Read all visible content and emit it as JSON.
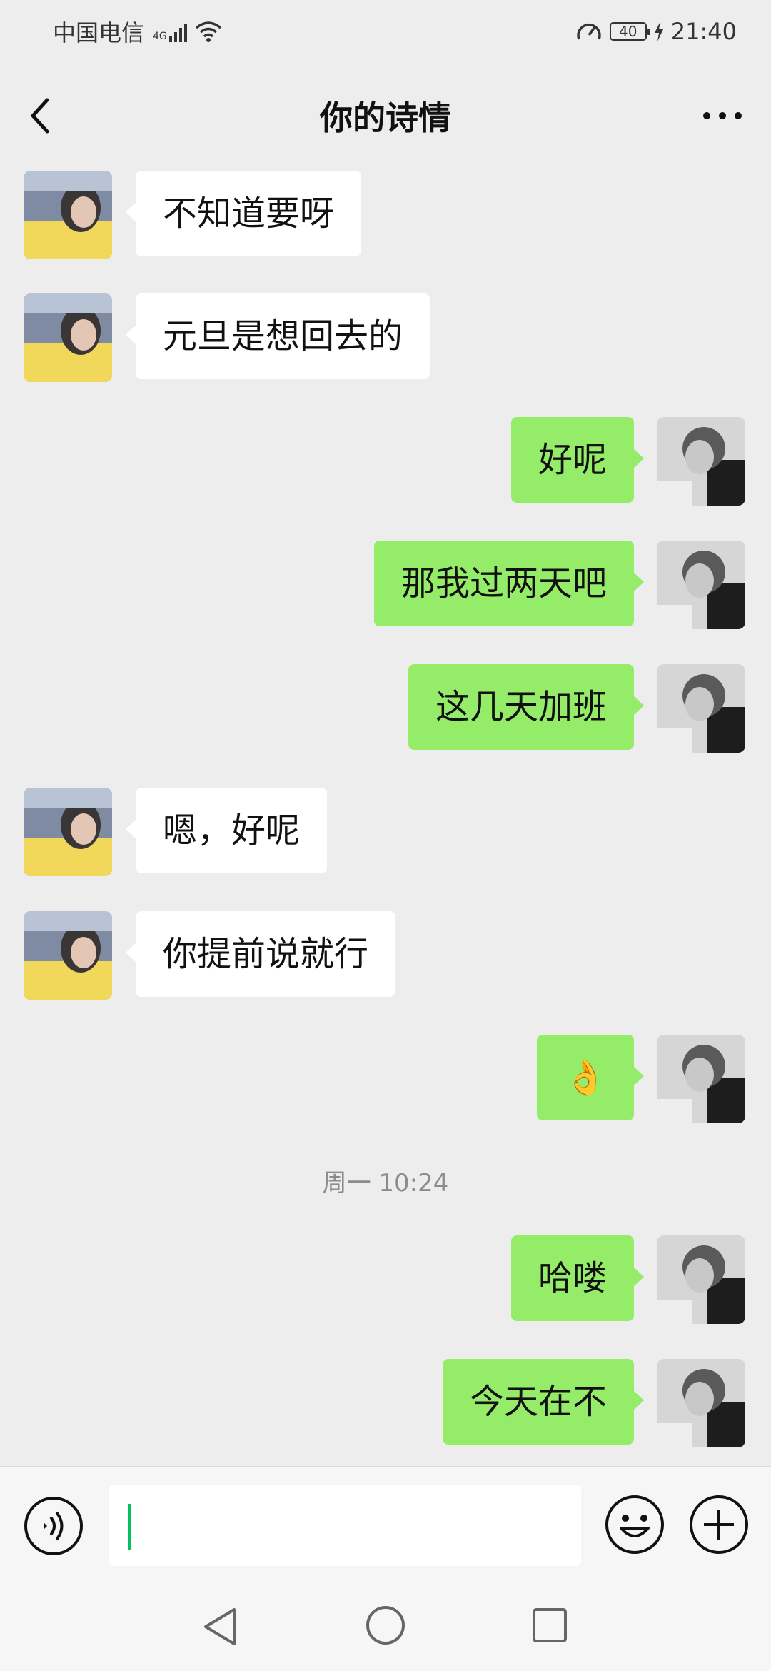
{
  "status_bar": {
    "carrier": "中国电信",
    "network_type": "4G",
    "battery": "40",
    "time": "21:40"
  },
  "header": {
    "title": "你的诗情",
    "back_icon": "chevron-left-icon",
    "more_icon": "more-horizontal-icon"
  },
  "messages": [
    {
      "side": "left",
      "text": "不知道要呀"
    },
    {
      "side": "left",
      "text": "元旦是想回去的"
    },
    {
      "side": "right",
      "text": "好呢"
    },
    {
      "side": "right",
      "text": "那我过两天吧"
    },
    {
      "side": "right",
      "text": "这几天加班"
    },
    {
      "side": "left",
      "text": "嗯，好呢"
    },
    {
      "side": "left",
      "text": "你提前说就行"
    },
    {
      "side": "right",
      "text": "👌"
    },
    {
      "side": "right",
      "text": "哈喽"
    },
    {
      "side": "right",
      "text": "今天在不"
    }
  ],
  "timestamp": "周一 10:24",
  "input_bar": {
    "voice_icon": "voice-icon",
    "emoji_icon": "emoji-icon",
    "plus_icon": "plus-icon",
    "value": ""
  },
  "nav_bar": {
    "back_icon": "triangle-back-icon",
    "home_icon": "circle-home-icon",
    "recent_icon": "square-recent-icon"
  },
  "colors": {
    "background": "#ededed",
    "outgoing_bubble": "#95ec69",
    "incoming_bubble": "#ffffff",
    "cursor": "#07c160"
  }
}
